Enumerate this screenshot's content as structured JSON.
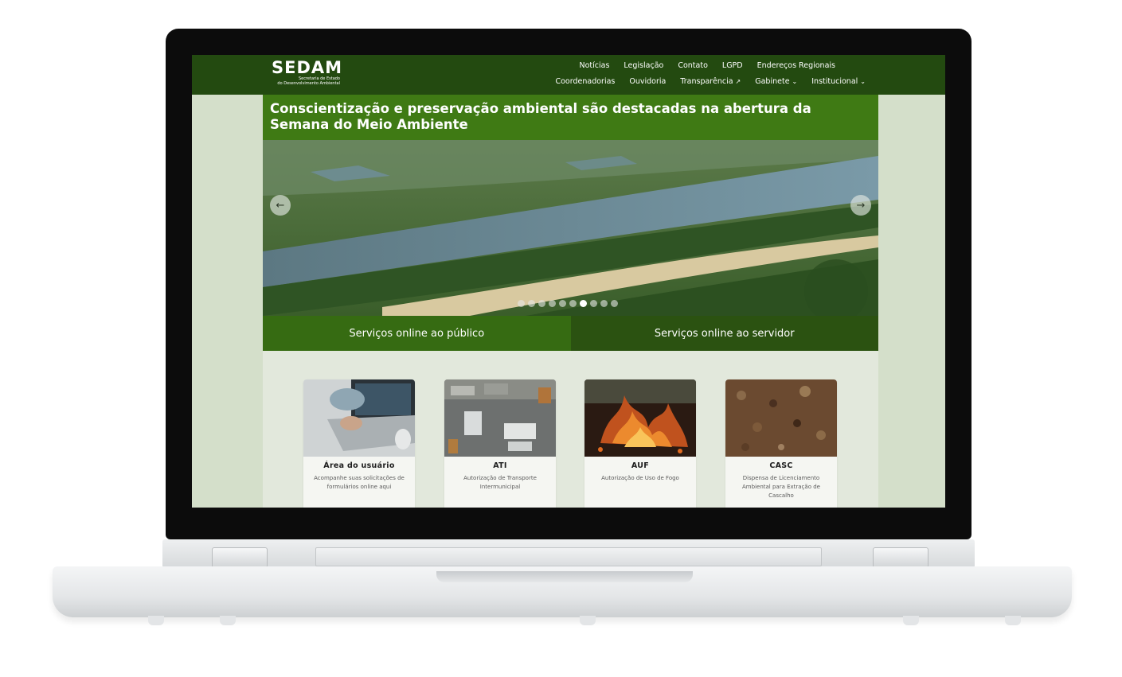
{
  "header": {
    "logo_title": "SEDAM",
    "logo_subtitle_line1": "Secretaria de Estado",
    "logo_subtitle_line2": "do Desenvolvimento Ambiental",
    "nav_top": [
      "Notícias",
      "Legislação",
      "Contato",
      "LGPD",
      "Endereços Regionais"
    ],
    "nav_bottom": [
      {
        "label": "Coordenadorias",
        "icon": ""
      },
      {
        "label": "Ouvidoria",
        "icon": ""
      },
      {
        "label": "Transparência",
        "icon": "external-link-icon"
      },
      {
        "label": "Gabinete",
        "icon": "chevron-down-icon"
      },
      {
        "label": "Institucional",
        "icon": "chevron-down-icon"
      }
    ]
  },
  "banner": {
    "headline": "Conscientização e preservação ambiental são destacadas na abertura da Semana do Meio Ambiente",
    "slide_count": 10,
    "active_slide": 7
  },
  "services": {
    "public_label": "Serviços online ao público",
    "staff_label": "Serviços online ao servidor"
  },
  "cards": [
    {
      "title": "Área do usuário",
      "desc_line1": "Acompanhe suas solicitações de",
      "desc_line2": "formulários online aqui",
      "desc_line3": ""
    },
    {
      "title": "ATI",
      "desc_line1": "Autorização de Transporte",
      "desc_line2": "Intermunicipal",
      "desc_line3": ""
    },
    {
      "title": "AUF",
      "desc_line1": "Autorização de Uso de Fogo",
      "desc_line2": "",
      "desc_line3": ""
    },
    {
      "title": "CASC",
      "desc_line1": "Dispensa de Licenciamento",
      "desc_line2": "Ambiental para Extração de",
      "desc_line3": "Cascalho"
    }
  ],
  "colors": {
    "header_bg": "#234a10",
    "headline_bg": "#3f7a14",
    "tab_public": "#366b12",
    "tab_staff": "#2b5211",
    "page_bg": "#d5e0cb"
  }
}
